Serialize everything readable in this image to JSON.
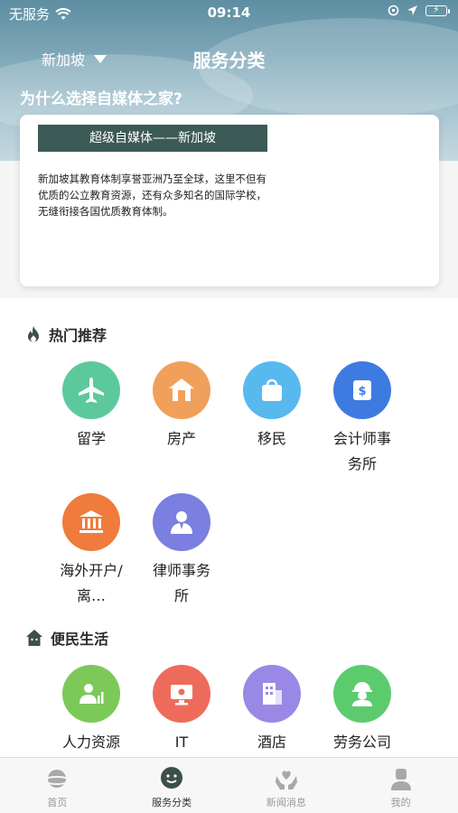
{
  "status": {
    "carrier": "无服务",
    "time": "09:14"
  },
  "nav": {
    "city": "新加坡",
    "title": "服务分类"
  },
  "intro": {
    "question": "为什么选择自媒体之家?",
    "banner": "超级自媒体——新加坡",
    "body": "新加坡其教育体制享誉亚洲乃至全球，这里不但有优质的公立教育资源，还有众多知名的国际学校，无缝衔接各国优质教育体制。"
  },
  "hot": {
    "title": "热门推荐",
    "items": [
      {
        "label": "留学",
        "icon": "airplane-icon",
        "color": "#5cc99c"
      },
      {
        "label": "房产",
        "icon": "house-icon",
        "color": "#f0a05a"
      },
      {
        "label": "移民",
        "icon": "bag-icon",
        "color": "#57b9ee"
      },
      {
        "label": "会计师事务所",
        "icon": "wallet-icon",
        "color": "#3e7be0"
      },
      {
        "label": "海外开户/离…",
        "icon": "bank-icon",
        "color": "#ef7b3c"
      },
      {
        "label": "律师事务所",
        "icon": "lawyer-icon",
        "color": "#7a7fe0"
      }
    ]
  },
  "life": {
    "title": "便民生活",
    "items": [
      {
        "label": "人力资源管理",
        "icon": "hr-icon",
        "color": "#7cc95a"
      },
      {
        "label": "IT",
        "icon": "computer-icon",
        "color": "#ee6b5c"
      },
      {
        "label": "酒店",
        "icon": "hotel-icon",
        "color": "#9a88e6"
      },
      {
        "label": "劳务公司",
        "icon": "worker-icon",
        "color": "#5ccb6e"
      }
    ]
  },
  "tabs": [
    {
      "label": "首页",
      "icon": "planet-icon"
    },
    {
      "label": "服务分类",
      "icon": "chat-icon"
    },
    {
      "label": "新闻消息",
      "icon": "heart-hands-icon"
    },
    {
      "label": "我的",
      "icon": "user-icon"
    }
  ]
}
